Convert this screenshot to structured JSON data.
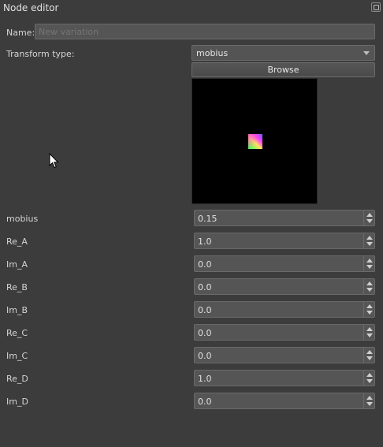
{
  "window": {
    "title": "Node editor",
    "float_icon": "float-icon"
  },
  "name": {
    "label": "Name:",
    "placeholder": "New variation",
    "value": ""
  },
  "transform": {
    "label": "Transform type:",
    "selected": "mobius",
    "browse_label": "Browse"
  },
  "params": [
    {
      "label": "mobius",
      "value": "0.15"
    },
    {
      "label": "Re_A",
      "value": "1.0"
    },
    {
      "label": "Im_A",
      "value": "0.0"
    },
    {
      "label": "Re_B",
      "value": "0.0"
    },
    {
      "label": "Im_B",
      "value": "0.0"
    },
    {
      "label": "Re_C",
      "value": "0.0"
    },
    {
      "label": "Im_C",
      "value": "0.0"
    },
    {
      "label": "Re_D",
      "value": "1.0"
    },
    {
      "label": "Im_D",
      "value": "0.0"
    }
  ],
  "colors": {
    "background": "#3c3c3c",
    "field": "#555555",
    "preview_bg": "#000000"
  }
}
